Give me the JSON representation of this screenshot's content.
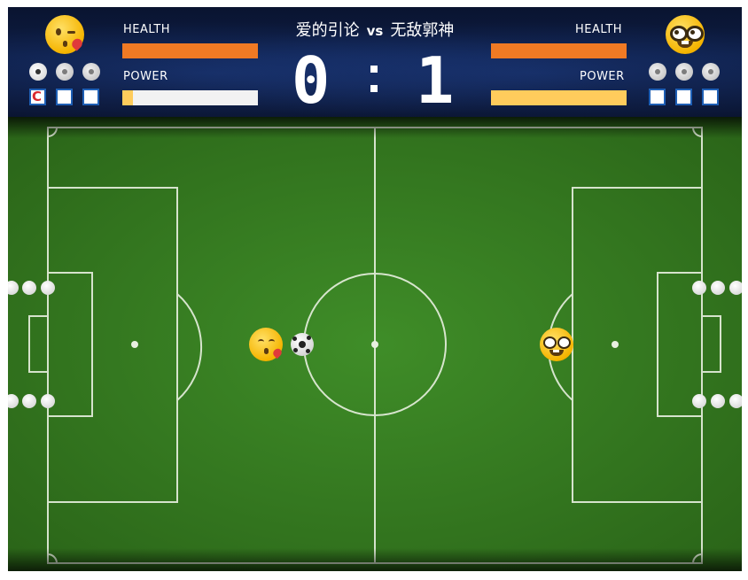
{
  "match": {
    "title_left": "爱的引论",
    "vs": "vs",
    "title_right": "无敌郭神"
  },
  "score": {
    "left": "0",
    "right": "1",
    "separator": ":"
  },
  "left_player": {
    "avatar_icon": "kissing-face-emoji-icon",
    "health_label": "HEALTH",
    "power_label": "POWER",
    "health": 1.0,
    "power": 0.08,
    "balls_remaining": 3,
    "items": [
      "magnet-icon",
      "empty",
      "empty"
    ]
  },
  "right_player": {
    "avatar_icon": "nerd-face-emoji-icon",
    "health_label": "HEALTH",
    "power_label": "POWER",
    "health": 1.0,
    "power": 1.0,
    "balls_remaining": 3,
    "items": [
      "empty",
      "empty",
      "empty"
    ]
  },
  "colors": {
    "health": "#f07a24",
    "power": "#ffcc5c",
    "bar_bg": "#f2f2f2",
    "pitch_light": "#3c8a26",
    "pitch_dark": "#2a6418",
    "lines": "#ffffff"
  }
}
